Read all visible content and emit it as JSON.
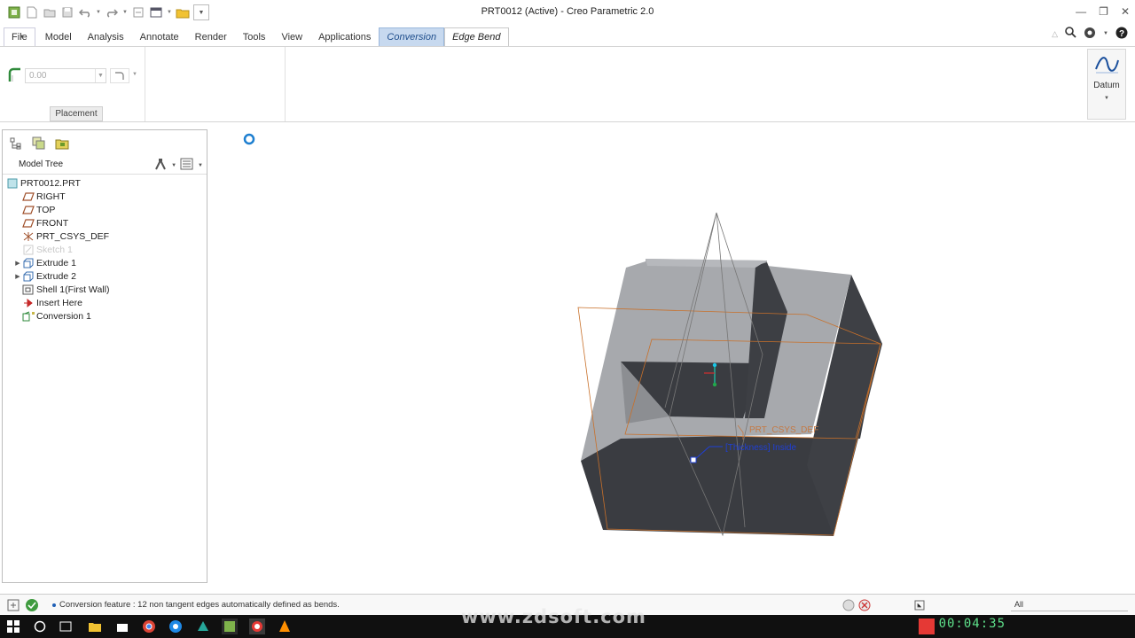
{
  "window": {
    "title": "PRT0012 (Active) - Creo Parametric 2.0"
  },
  "tabs": [
    {
      "label": "File",
      "kind": "file"
    },
    {
      "label": "Model"
    },
    {
      "label": "Analysis"
    },
    {
      "label": "Annotate"
    },
    {
      "label": "Render"
    },
    {
      "label": "Tools"
    },
    {
      "label": "View"
    },
    {
      "label": "Applications"
    },
    {
      "label": "Conversion",
      "kind": "conv"
    },
    {
      "label": "Edge Bend",
      "kind": "active"
    }
  ],
  "ribbon": {
    "value_input": "0.00",
    "placement_label": "Placement",
    "datum_label": "Datum"
  },
  "tree": {
    "title": "Model Tree",
    "items": [
      {
        "label": "PRT0012.PRT",
        "icon": "part-icon",
        "indent": 0
      },
      {
        "label": "RIGHT",
        "icon": "datum-plane-icon",
        "indent": 1
      },
      {
        "label": "TOP",
        "icon": "datum-plane-icon",
        "indent": 1
      },
      {
        "label": "FRONT",
        "icon": "datum-plane-icon",
        "indent": 1
      },
      {
        "label": "PRT_CSYS_DEF",
        "icon": "csys-icon",
        "indent": 1
      },
      {
        "label": "Sketch 1",
        "icon": "sketch-icon",
        "indent": 1,
        "dim": true
      },
      {
        "label": "Extrude 1",
        "icon": "extrude-icon",
        "indent": 1,
        "expand": true
      },
      {
        "label": "Extrude 2",
        "icon": "extrude-icon",
        "indent": 1,
        "expand": true
      },
      {
        "label": "Shell 1(First Wall)",
        "icon": "shell-icon",
        "indent": 1
      },
      {
        "label": "Insert Here",
        "icon": "insert-arrow-icon",
        "indent": 1
      },
      {
        "label": "Conversion 1",
        "icon": "conversion-icon",
        "indent": 1
      }
    ]
  },
  "viewport": {
    "csys_label": "PRT_CSYS_DEF",
    "thickness_label": "[Thickness] Inside"
  },
  "status": {
    "message": "Conversion feature : 12 non tangent edges automatically defined as bends.",
    "filter": "All"
  },
  "overlay": {
    "watermark": "www.zdsoft.com",
    "clock": "00:04:35"
  },
  "colors": {
    "conv_tab": "#c7d9ef",
    "model_light": "#a9abaf",
    "model_dark": "#3b3d42",
    "annotation_blue": "#1f3fd6",
    "wire_orange": "#c8702a"
  }
}
